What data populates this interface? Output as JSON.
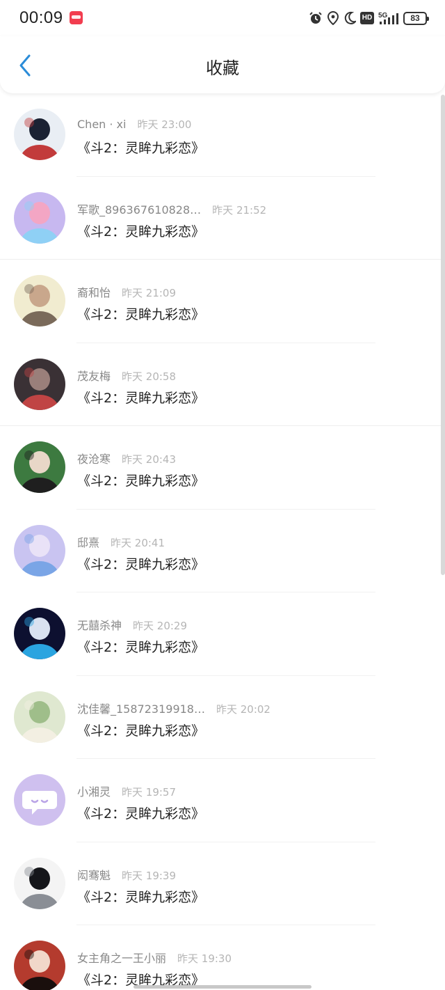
{
  "status_bar": {
    "time": "00:09",
    "network": "5G",
    "hd": "HD",
    "battery": "83"
  },
  "header": {
    "title": "收藏",
    "back_icon": "chevron-left-icon",
    "accent_color": "#2b8cd8"
  },
  "favorites": [
    {
      "username": "Chen · xi",
      "time": "昨天 23:00",
      "title": "《斗2：灵眸九彩恋》",
      "avatar_colors": [
        "#e9eef4",
        "#1b2233",
        "#c23b3b"
      ]
    },
    {
      "username": "军歌_896367610828…",
      "time": "昨天 21:52",
      "title": "《斗2：灵眸九彩恋》",
      "avatar_colors": [
        "#c7b8f0",
        "#f3a6c4",
        "#8fd0f5"
      ]
    },
    {
      "username": "裔和怡",
      "time": "昨天 21:09",
      "title": "《斗2：灵眸九彩恋》",
      "avatar_colors": [
        "#f1ecd0",
        "#c9a78c",
        "#7a6a5a"
      ]
    },
    {
      "username": "茂友梅",
      "time": "昨天 20:58",
      "title": "《斗2：灵眸九彩恋》",
      "avatar_colors": [
        "#3a3135",
        "#9a7f7a",
        "#c04444"
      ]
    },
    {
      "username": "夜沧寒",
      "time": "昨天 20:43",
      "title": "《斗2：灵眸九彩恋》",
      "avatar_colors": [
        "#3d7a40",
        "#e8d7c7",
        "#1f1f1f"
      ]
    },
    {
      "username": "邸熹",
      "time": "昨天 20:41",
      "title": "《斗2：灵眸九彩恋》",
      "avatar_colors": [
        "#c9c4f1",
        "#e9e2f7",
        "#7aa5e6"
      ]
    },
    {
      "username": "无囍杀神",
      "time": "昨天 20:29",
      "title": "《斗2：灵眸九彩恋》",
      "avatar_colors": [
        "#0d1030",
        "#d9e2f0",
        "#2aa4e0"
      ]
    },
    {
      "username": "沈佳馨_15872319918…",
      "time": "昨天 20:02",
      "title": "《斗2：灵眸九彩恋》",
      "avatar_colors": [
        "#dfe8d0",
        "#9fbe8a",
        "#f3efe2"
      ]
    },
    {
      "username": "小湘灵",
      "time": "昨天 19:57",
      "title": "《斗2：灵眸九彩恋》",
      "avatar_colors": [
        "#cfc0ef",
        "#ffffff",
        "#b9a3e6"
      ]
    },
    {
      "username": "闳骞魁",
      "time": "昨天 19:39",
      "title": "《斗2：灵眸九彩恋》",
      "avatar_colors": [
        "#f4f4f4",
        "#15161a",
        "#8a8e95"
      ]
    },
    {
      "username": "女主角之一王小丽",
      "time": "昨天 19:30",
      "title": "《斗2：灵眸九彩恋》",
      "avatar_colors": [
        "#b43b2e",
        "#f1d7c9",
        "#1a0f0d"
      ]
    }
  ]
}
